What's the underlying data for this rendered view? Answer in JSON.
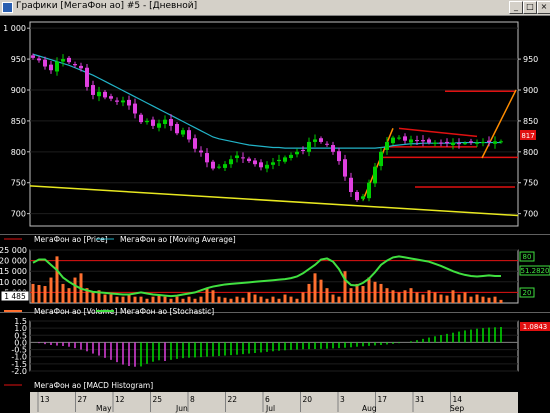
{
  "window": {
    "title": "Графики [МегаФон ао] #5 - [Дневной]",
    "buttons": [
      "_",
      "□",
      "×"
    ]
  },
  "legends": {
    "price": {
      "price_label": "МегаФон ао [Price]",
      "ma_label": "МегаФон ао [Moving Average]"
    },
    "volume": {
      "volume_label": "МегаФон ао [Volume]",
      "stoch_label": "МегаФон ао [Stochastic]"
    },
    "macd": {
      "macd_label": "МегаФон ао [MACD Histogram]"
    }
  },
  "axes": {
    "price_ticks": [
      "1 000",
      "950",
      "900",
      "850",
      "800",
      "750",
      "700"
    ],
    "price_ticks_right": [
      "950",
      "900",
      "850",
      "800",
      "750",
      "700"
    ],
    "volume_ticks": [
      "25 000",
      "20 000",
      "15 000",
      "10 000",
      "5 000"
    ],
    "volume_badge": "1 485",
    "macd_ticks": [
      "1.5",
      "1.0",
      "0.5",
      "0.0",
      "-0.5",
      "-1.0",
      "-1.5",
      "-2.0"
    ],
    "right_badges": {
      "price_current": "817",
      "stoch_upper": "80",
      "stoch_current": "51.2820",
      "stoch_lower": "20",
      "macd_current": "1.0843"
    }
  },
  "date_axis": {
    "days": [
      "13",
      "27",
      "12",
      "25",
      "8",
      "22",
      "6",
      "20",
      "3",
      "17",
      "31",
      "14"
    ],
    "months": [
      "May",
      "Jun",
      "Jul",
      "Aug",
      "Sep"
    ]
  },
  "colors": {
    "background": "#000000",
    "bull": "#00d000",
    "bear": "#e040e0",
    "moving_average": "#22b4c8",
    "trend_yellow": "#e8e820",
    "trend_orange": "#ff8c00",
    "level_red": "#e01010",
    "volume": "#ff7030",
    "stochastic": "#40e040",
    "macd_up": "#00e000",
    "macd_down": "#e040e0"
  },
  "chart_data": [
    {
      "type": "line",
      "subtype": "candlestick",
      "series": [
        {
          "name": "МегаФон ао [Price]",
          "values": [
            952,
            948,
            938,
            932,
            946,
            950,
            945,
            940,
            935,
            905,
            892,
            897,
            888,
            886,
            881,
            883,
            875,
            862,
            848,
            850,
            842,
            846,
            852,
            842,
            830,
            835,
            820,
            805,
            799,
            783,
            773,
            776,
            780,
            788,
            794,
            790,
            785,
            780,
            775,
            779,
            783,
            787,
            791,
            795,
            800,
            802,
            816,
            820,
            816,
            812,
            800,
            785,
            760,
            735,
            722,
            728,
            750,
            776,
            800,
            816,
            823,
            823,
            818,
            820,
            818,
            817,
            815,
            815,
            814,
            814,
            815,
            813,
            814,
            815,
            815,
            816,
            816,
            817,
            817
          ]
        },
        {
          "name": "МегаФон ао [Moving Average]",
          "values": [
            958,
            955,
            952,
            949,
            946,
            943,
            940,
            936,
            932,
            928,
            924,
            919,
            914,
            909,
            904,
            899,
            894,
            889,
            884,
            879,
            874,
            869,
            864,
            859,
            854,
            849,
            844,
            839,
            834,
            829,
            824,
            821,
            819,
            817,
            815,
            813,
            811,
            810,
            809,
            808,
            807,
            807,
            806,
            806,
            806,
            806,
            806,
            806,
            806,
            806,
            806,
            806,
            806,
            806,
            806,
            806,
            806,
            806,
            807,
            808,
            810,
            811,
            812,
            813,
            813,
            814,
            814,
            814,
            814,
            814,
            814,
            815,
            815,
            815,
            815,
            815,
            815,
            815,
            815
          ]
        }
      ],
      "ylim": [
        680,
        1010
      ]
    },
    {
      "type": "bar",
      "series": [
        {
          "name": "МегаФон ао [Volume]",
          "values": [
            9000,
            8500,
            8000,
            12000,
            22000,
            9000,
            7000,
            12000,
            14000,
            7000,
            5000,
            6000,
            4000,
            4000,
            3000,
            3000,
            4000,
            3000,
            3000,
            2000,
            3000,
            4000,
            3000,
            2000,
            3000,
            2000,
            3000,
            2000,
            3000,
            7000,
            6000,
            3000,
            2500,
            2000,
            3000,
            2500,
            5000,
            4000,
            3000,
            2000,
            3000,
            2000,
            4000,
            3000,
            2000,
            5000,
            9000,
            14000,
            11000,
            7000,
            4000,
            3000,
            15000,
            7000,
            9000,
            8000,
            12000,
            10000,
            9000,
            7000,
            6000,
            5000,
            6000,
            7000,
            5000,
            4000,
            6000,
            5000,
            4000,
            3500,
            6000,
            4000,
            5000,
            3000,
            4000,
            3000,
            2500,
            3000,
            1485
          ]
        },
        {
          "name": "МегаФон ао [Stochastic]",
          "values": [
            76,
            82,
            82,
            72,
            62,
            48,
            40,
            33,
            27,
            24,
            21,
            20,
            19,
            18,
            17,
            16,
            16,
            18,
            20,
            18,
            16,
            15,
            14,
            13,
            14,
            16,
            18,
            20,
            24,
            28,
            31,
            33,
            35,
            36,
            37,
            38,
            39,
            40,
            41,
            42,
            43,
            44,
            45,
            47,
            50,
            56,
            64,
            72,
            82,
            84,
            78,
            64,
            44,
            34,
            33,
            38,
            46,
            58,
            72,
            80,
            86,
            88,
            86,
            84,
            82,
            80,
            78,
            74,
            70,
            65,
            60,
            56,
            53,
            51,
            50,
            51,
            52,
            51,
            51
          ]
        }
      ],
      "ylim": [
        0,
        25000
      ],
      "levels": [
        80,
        20
      ]
    },
    {
      "type": "bar",
      "series": [
        {
          "name": "МегаФон ао [MACD Histogram]",
          "values": [
            0.0,
            -0.05,
            -0.12,
            -0.18,
            -0.22,
            -0.25,
            -0.3,
            -0.4,
            -0.5,
            -0.62,
            -0.78,
            -0.92,
            -1.08,
            -1.22,
            -1.38,
            -1.55,
            -1.65,
            -1.7,
            -1.68,
            -1.5,
            -1.35,
            -1.25,
            -1.3,
            -1.22,
            -1.15,
            -1.1,
            -1.07,
            -1.05,
            -1.03,
            -1.0,
            -0.98,
            -0.95,
            -0.92,
            -0.89,
            -0.86,
            -0.82,
            -0.78,
            -0.74,
            -0.7,
            -0.66,
            -0.62,
            -0.58,
            -0.55,
            -0.52,
            -0.5,
            -0.48,
            -0.47,
            -0.46,
            -0.45,
            -0.44,
            -0.42,
            -0.4,
            -0.37,
            -0.34,
            -0.3,
            -0.27,
            -0.24,
            -0.21,
            -0.18,
            -0.14,
            -0.1,
            -0.05,
            0.0,
            0.08,
            0.16,
            0.25,
            0.34,
            0.43,
            0.52,
            0.6,
            0.68,
            0.76,
            0.84,
            0.9,
            0.96,
            1.0,
            1.04,
            1.06,
            1.08
          ]
        }
      ],
      "ylim": [
        -2.0,
        1.5
      ]
    }
  ]
}
